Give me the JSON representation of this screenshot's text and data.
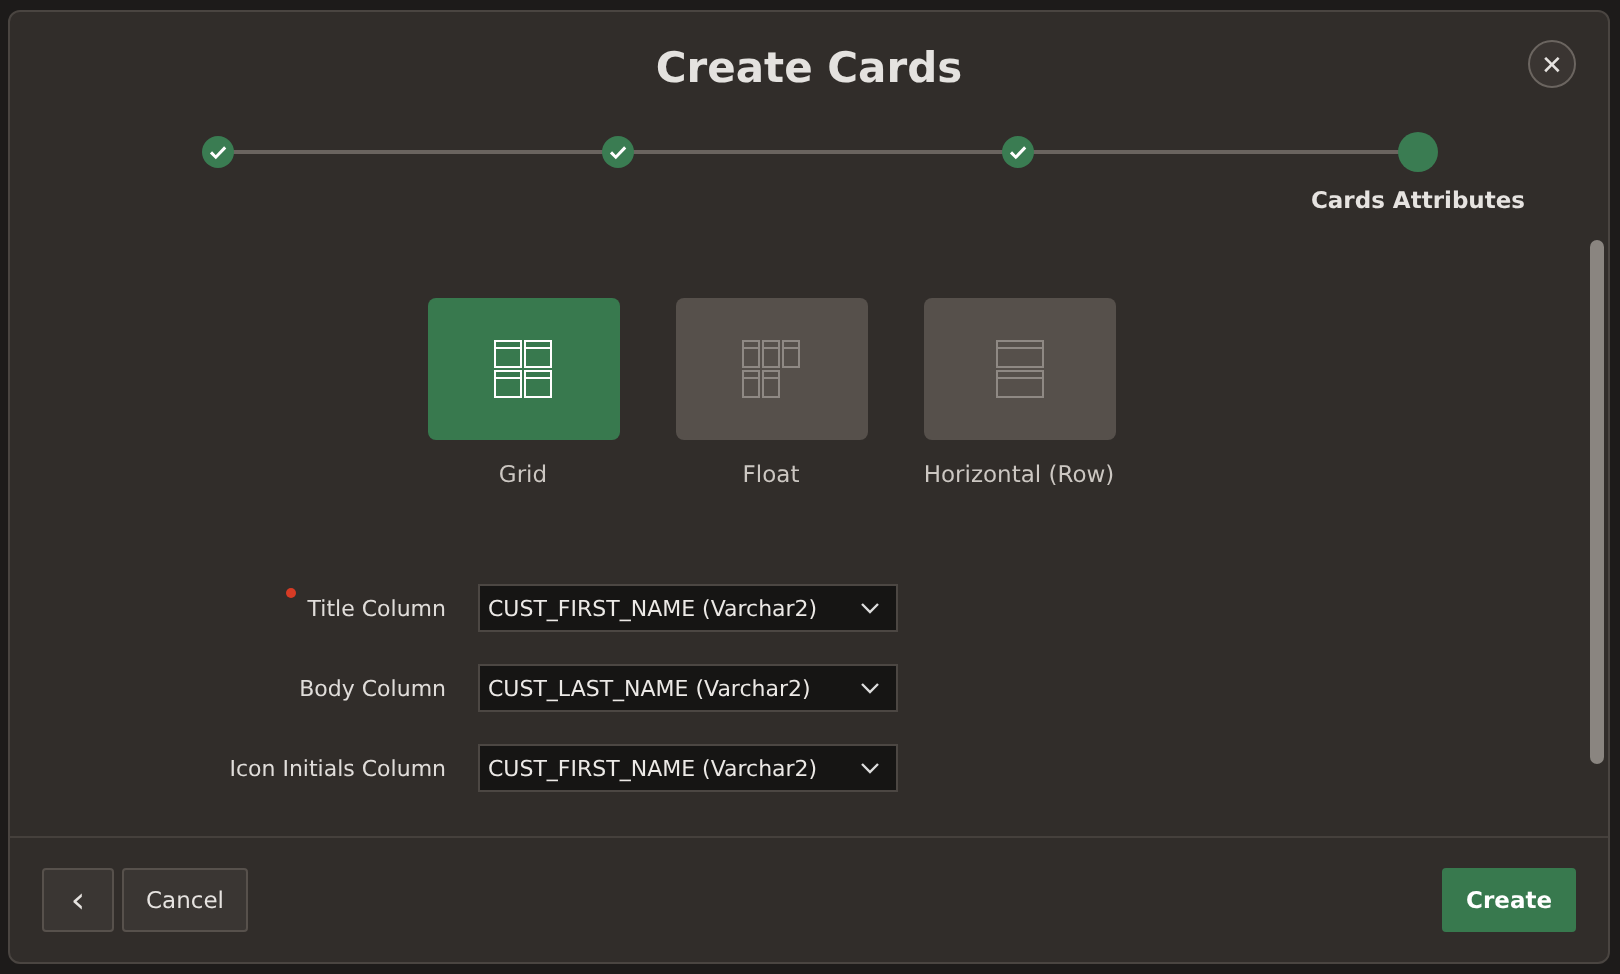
{
  "dialog": {
    "title": "Create Cards",
    "close_icon": "✕"
  },
  "steps": [
    {
      "completed": true
    },
    {
      "completed": true
    },
    {
      "completed": true
    },
    {
      "completed": false,
      "label": "Cards Attributes"
    }
  ],
  "layouts": [
    {
      "kind": "grid",
      "label": "Grid",
      "selected": true
    },
    {
      "kind": "float",
      "label": "Float",
      "selected": false
    },
    {
      "kind": "horizontal",
      "label": "Horizontal (Row)",
      "selected": false
    }
  ],
  "fields": [
    {
      "label": "Title Column",
      "required": true,
      "value": "CUST_FIRST_NAME (Varchar2)"
    },
    {
      "label": "Body Column",
      "required": false,
      "value": "CUST_LAST_NAME (Varchar2)"
    },
    {
      "label": "Icon Initials Column",
      "required": false,
      "value": "CUST_FIRST_NAME (Varchar2)"
    }
  ],
  "footer": {
    "back_icon": "‹",
    "cancel": "Cancel",
    "create": "Create"
  }
}
